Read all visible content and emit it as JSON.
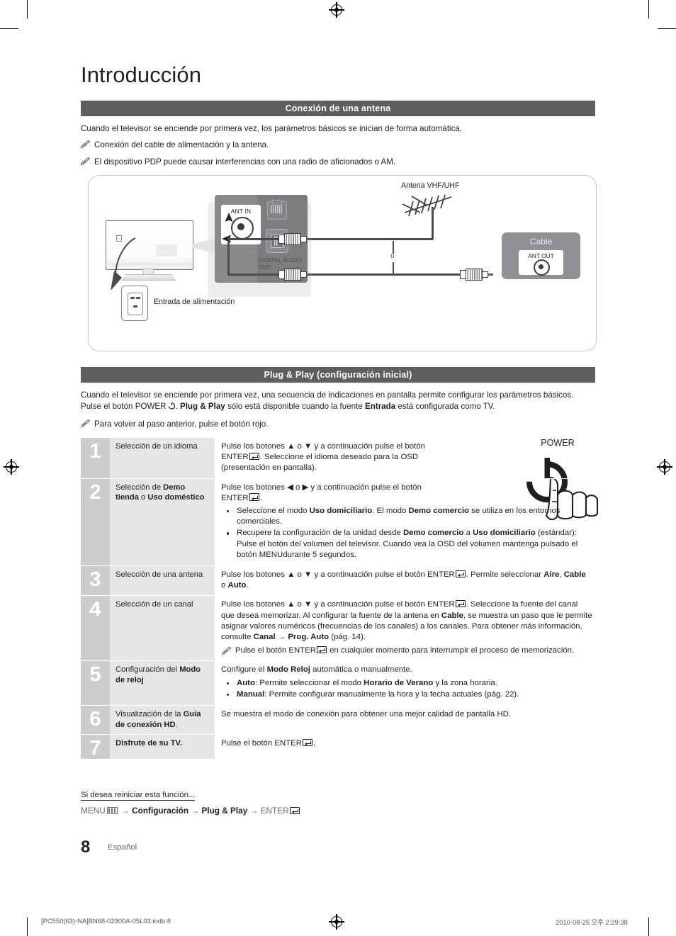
{
  "document": {
    "title": "Introducción",
    "page_number": "8",
    "language_label": "Español"
  },
  "sections": [
    {
      "id": "antenna",
      "heading": "Conexión de una antena"
    },
    {
      "id": "plugplay",
      "heading": "Plug & Play (configuración inicial)"
    }
  ],
  "antenna_section": {
    "intro": "Cuando el televisor se enciende por primera vez, los parámetros básicos se inician de forma automática.",
    "notes": [
      "Conexión del cable de alimentación y la antena.",
      "El dispositivo PDP puede causar interferencias con una radio de aficionados o AM."
    ]
  },
  "diagram": {
    "labels": {
      "antenna": "Antena VHF/UHF",
      "power_input": "Entrada de alimentación",
      "cable_box": "Cable",
      "ant_out": "ANT OUT",
      "ant_in": "ANT IN",
      "digital_audio": "DIGITAL AUDIO OUT",
      "or_separator": "o"
    }
  },
  "plugplay_section": {
    "intro_part1": "Cuando el televisor se enciende por primera vez, una secuencia de indicaciones en pantalla permite configurar los parámetros básicos. Pulse el botón ",
    "power_word": "POWER",
    "intro_part2": ". ",
    "plugplay_bold": "Plug & Play",
    "intro_part3": " sólo está disponible cuando la fuente ",
    "entrada_bold": "Entrada",
    "intro_part4": " está configurada como TV.",
    "note": "Para volver al paso anterior, pulse el botón rojo."
  },
  "steps": [
    {
      "number": "1",
      "title_plain": "Selección de un idioma",
      "body_line1_a": "Pulse los botones ▲ o ▼ y a continuación pulse el botón",
      "body_line2_a": "ENTER",
      "body_line2_b": ". Seleccione el idioma deseado para la OSD",
      "body_line3": "(presentación en pantalla)."
    },
    {
      "number": "2",
      "title_a": "Selección de ",
      "title_b": "Demo tienda",
      "title_c": " o ",
      "title_d": "Uso doméstico",
      "body_line1": "Pulse los botones ◀ o ▶ y a continuación pulse el botón",
      "body_line2_a": "ENTER",
      "body_line2_b": ".",
      "bullets": [
        {
          "p1": "Seleccione el modo ",
          "b1": "Uso domiciliario",
          "p2": ". El modo ",
          "b2": "Demo comercio",
          "p3": " se utiliza en los entornos comerciales."
        },
        {
          "p1": "Recupere la configuración de la unidad desde ",
          "b1": "Demo comercio",
          "p2": " a ",
          "b2": "Uso domiciliario",
          "p3": " (estándar): Pulse el botón del volumen del televisor. Cuando vea la OSD del volumen mantenga pulsado el botón MENUdurante 5 segundos."
        }
      ]
    },
    {
      "number": "3",
      "title_plain": "Selección de una antena",
      "body_p1": "Pulse los botones ▲ o ▼ y a continuación pulse el botón ENTER",
      "body_p2": ". Permite seleccionar ",
      "body_b1": "Aire",
      "body_p3": ", ",
      "body_b2": "Cable",
      "body_p4": " o ",
      "body_b3": "Auto",
      "body_p5": "."
    },
    {
      "number": "4",
      "title_plain": "Selección de un canal",
      "body_p1": "Pulse los botones ▲ o ▼ y a continuación pulse el botón ENTER",
      "body_p2": ". Seleccione la fuente del canal que desea memorizar. Al configurar la fuente de la antena en ",
      "body_b1": "Cable",
      "body_p3": ", se muestra un paso que le permite asignar valores numéricos (frecuencias de los canales) a los canales. Para obtener más información, consulte ",
      "body_b2": "Canal → Prog. Auto",
      "body_p4": " (pág. 14).",
      "note_p1": "Pulse el botón ENTER",
      "note_p2": " en cualquier momento para interrumpir el proceso de memorización."
    },
    {
      "number": "5",
      "title_a": "Configuración del ",
      "title_b": "Modo de reloj",
      "body_p1": "Configure el ",
      "body_b1": "Modo Reloj",
      "body_p2": " automática o manualmente.",
      "bullets": [
        {
          "b1": "Auto",
          "p1": ": Permite seleccionar el modo ",
          "b2": "Horario de Verano",
          "p2": " y la zona horaria."
        },
        {
          "b1": "Manual",
          "p1": ": Permite configurar manualmente la hora y la fecha actuales (pág. 22).",
          "b2": "",
          "p2": ""
        }
      ]
    },
    {
      "number": "6",
      "title_a": "Visualización de la ",
      "title_b": "Guía de conexión HD",
      "title_c": ".",
      "body_plain": "Se muestra el modo de conexión para obtener una mejor calidad de pantalla HD."
    },
    {
      "number": "7",
      "title_b": "Disfrute de su TV.",
      "body_p1": "Pulse el botón ENTER",
      "body_p2": "."
    }
  ],
  "power_graphic": {
    "label": "POWER"
  },
  "reinit": {
    "heading": "Si desea reiniciar esta función...",
    "path_menu": "MENU",
    "path_arrow1": " → ",
    "path_config": "Configuración",
    "path_arrow2": " → ",
    "path_plugplay": "Plug & Play",
    "path_arrow3": " → ",
    "path_enter": "ENTER"
  },
  "print_footer": {
    "file": "[PC550(63)-NA]BN68-02900A-05L03.indb   8",
    "datetime": "2010-08-25   오후 2:29:38"
  },
  "colors": {
    "section_bar": "#5f5e5e",
    "step_number_bg": "#cdcdcd",
    "step_title_bg": "#e6e6e6",
    "text": "#231f20"
  }
}
